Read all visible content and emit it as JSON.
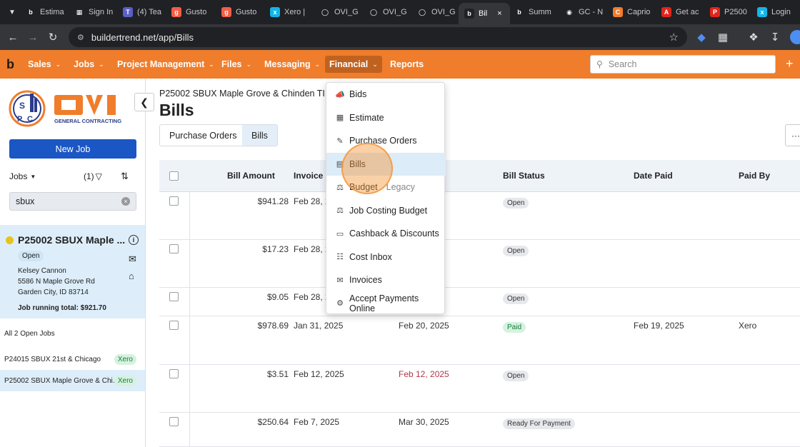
{
  "browser": {
    "tabs": [
      {
        "label": "Estima",
        "icon": "buildertrend-icon",
        "color": "#202124"
      },
      {
        "label": "Sign In",
        "icon": "microsoft-icon",
        "color": "#202124"
      },
      {
        "label": "(4) Tea",
        "icon": "teams-icon",
        "color": "#5b5fc7"
      },
      {
        "label": "Gusto",
        "icon": "gusto-icon",
        "color": "#f45d48"
      },
      {
        "label": "Gusto",
        "icon": "gusto-icon",
        "color": "#f45d48"
      },
      {
        "label": "Xero | ",
        "icon": "xero-icon",
        "color": "#13b5ea"
      },
      {
        "label": "OVI_G",
        "icon": "globe-icon",
        "color": "#202124"
      },
      {
        "label": "OVI_G",
        "icon": "globe-icon",
        "color": "#202124"
      },
      {
        "label": "OVI_G",
        "icon": "globe-icon",
        "color": "#202124"
      },
      {
        "label": "Bil",
        "icon": "buildertrend-icon",
        "color": "#202124",
        "active": true
      },
      {
        "label": "Summ",
        "icon": "buildertrend-icon",
        "color": "#202124"
      },
      {
        "label": "GC - N",
        "icon": "github-icon",
        "color": "#202124"
      },
      {
        "label": "Caprio",
        "icon": "caprio-icon",
        "color": "#f07d2b"
      },
      {
        "label": "Get ac",
        "icon": "adobe-icon",
        "color": "#e1251b"
      },
      {
        "label": "P2500",
        "icon": "pdf-icon",
        "color": "#e1251b"
      },
      {
        "label": "Login",
        "icon": "xero-icon",
        "color": "#13b5ea"
      }
    ],
    "url": "buildertrend.net/app/Bills"
  },
  "appnav": {
    "logo": "b",
    "items": [
      "Sales",
      "Jobs",
      "Project Management",
      "Files",
      "Messaging",
      "Financial",
      "Reports"
    ],
    "search_placeholder": "Search"
  },
  "sidebar": {
    "new_job": "New Job",
    "jobs_label": "Jobs",
    "filter_count": "(1)",
    "search_value": "sbux",
    "job": {
      "title": "P25002 SBUX Maple ...",
      "status": "Open",
      "contact": "Kelsey Cannon",
      "address1": "5586 N Maple Grove Rd",
      "address2": "Garden City, ID 83714",
      "running_total": "Job running total: $921.70"
    },
    "all_open_jobs": "All 2 Open Jobs",
    "job_list": [
      {
        "name": "P24015 SBUX 21st & Chicago",
        "badge": "Xero"
      },
      {
        "name": "P25002 SBUX Maple Grove & Chi...",
        "badge": "Xero"
      }
    ]
  },
  "main": {
    "job_title": "P25002 SBUX Maple Grove & Chinden TI",
    "page_title": "Bills",
    "segments": [
      "Purchase Orders",
      "Bills"
    ],
    "more": "···",
    "columns": [
      "Bill Amount",
      "Invoice D",
      "Bill Status",
      "Date Paid",
      "Paid By"
    ],
    "rows": [
      {
        "amount": "$941.28",
        "invoice": "Feb 28, 2",
        "due": "",
        "due_overdue": false,
        "status": "Open",
        "paid": "",
        "paid_by": ""
      },
      {
        "amount": "$17.23",
        "invoice": "Feb 28, 2",
        "due": "",
        "due_overdue": false,
        "status": "Open",
        "paid": "",
        "paid_by": ""
      },
      {
        "amount": "$9.05",
        "invoice": "Feb 28, 2",
        "due": "",
        "due_overdue": false,
        "status": "Open",
        "paid": "",
        "paid_by": ""
      },
      {
        "amount": "$978.69",
        "invoice": "Jan 31, 2025",
        "due": "Feb 20, 2025",
        "due_overdue": false,
        "status": "Paid",
        "paid": "Feb 19, 2025",
        "paid_by": "Xero"
      },
      {
        "amount": "$3.51",
        "invoice": "Feb 12, 2025",
        "due": "Feb 12, 2025",
        "due_overdue": true,
        "status": "Open",
        "paid": "",
        "paid_by": ""
      },
      {
        "amount": "$250.64",
        "invoice": "Feb 7, 2025",
        "due": "Mar 30, 2025",
        "due_overdue": false,
        "status": "Ready For Payment",
        "paid": "",
        "paid_by": ""
      }
    ]
  },
  "dropdown": {
    "items": [
      {
        "label": "Bids",
        "icon": "megaphone-icon"
      },
      {
        "label": "Estimate",
        "icon": "calculator-icon"
      },
      {
        "label": "Purchase Orders",
        "icon": "purchase-order-icon"
      },
      {
        "label": "Bills",
        "icon": "bill-icon"
      },
      {
        "label": "Budget",
        "suffix": "Legacy",
        "icon": "scale-icon"
      },
      {
        "label": "Job Costing Budget",
        "icon": "scale-icon"
      },
      {
        "label": "Cashback & Discounts",
        "icon": "ticket-icon"
      },
      {
        "label": "Cost Inbox",
        "icon": "receipt-icon"
      },
      {
        "label": "Invoices",
        "icon": "invoice-icon"
      },
      {
        "label": "Accept Payments Online",
        "icon": "gear-dollar-icon"
      }
    ]
  },
  "colors": {
    "brand": "#f07d2b",
    "primary": "#1a56c4",
    "overdue": "#b0384a"
  }
}
